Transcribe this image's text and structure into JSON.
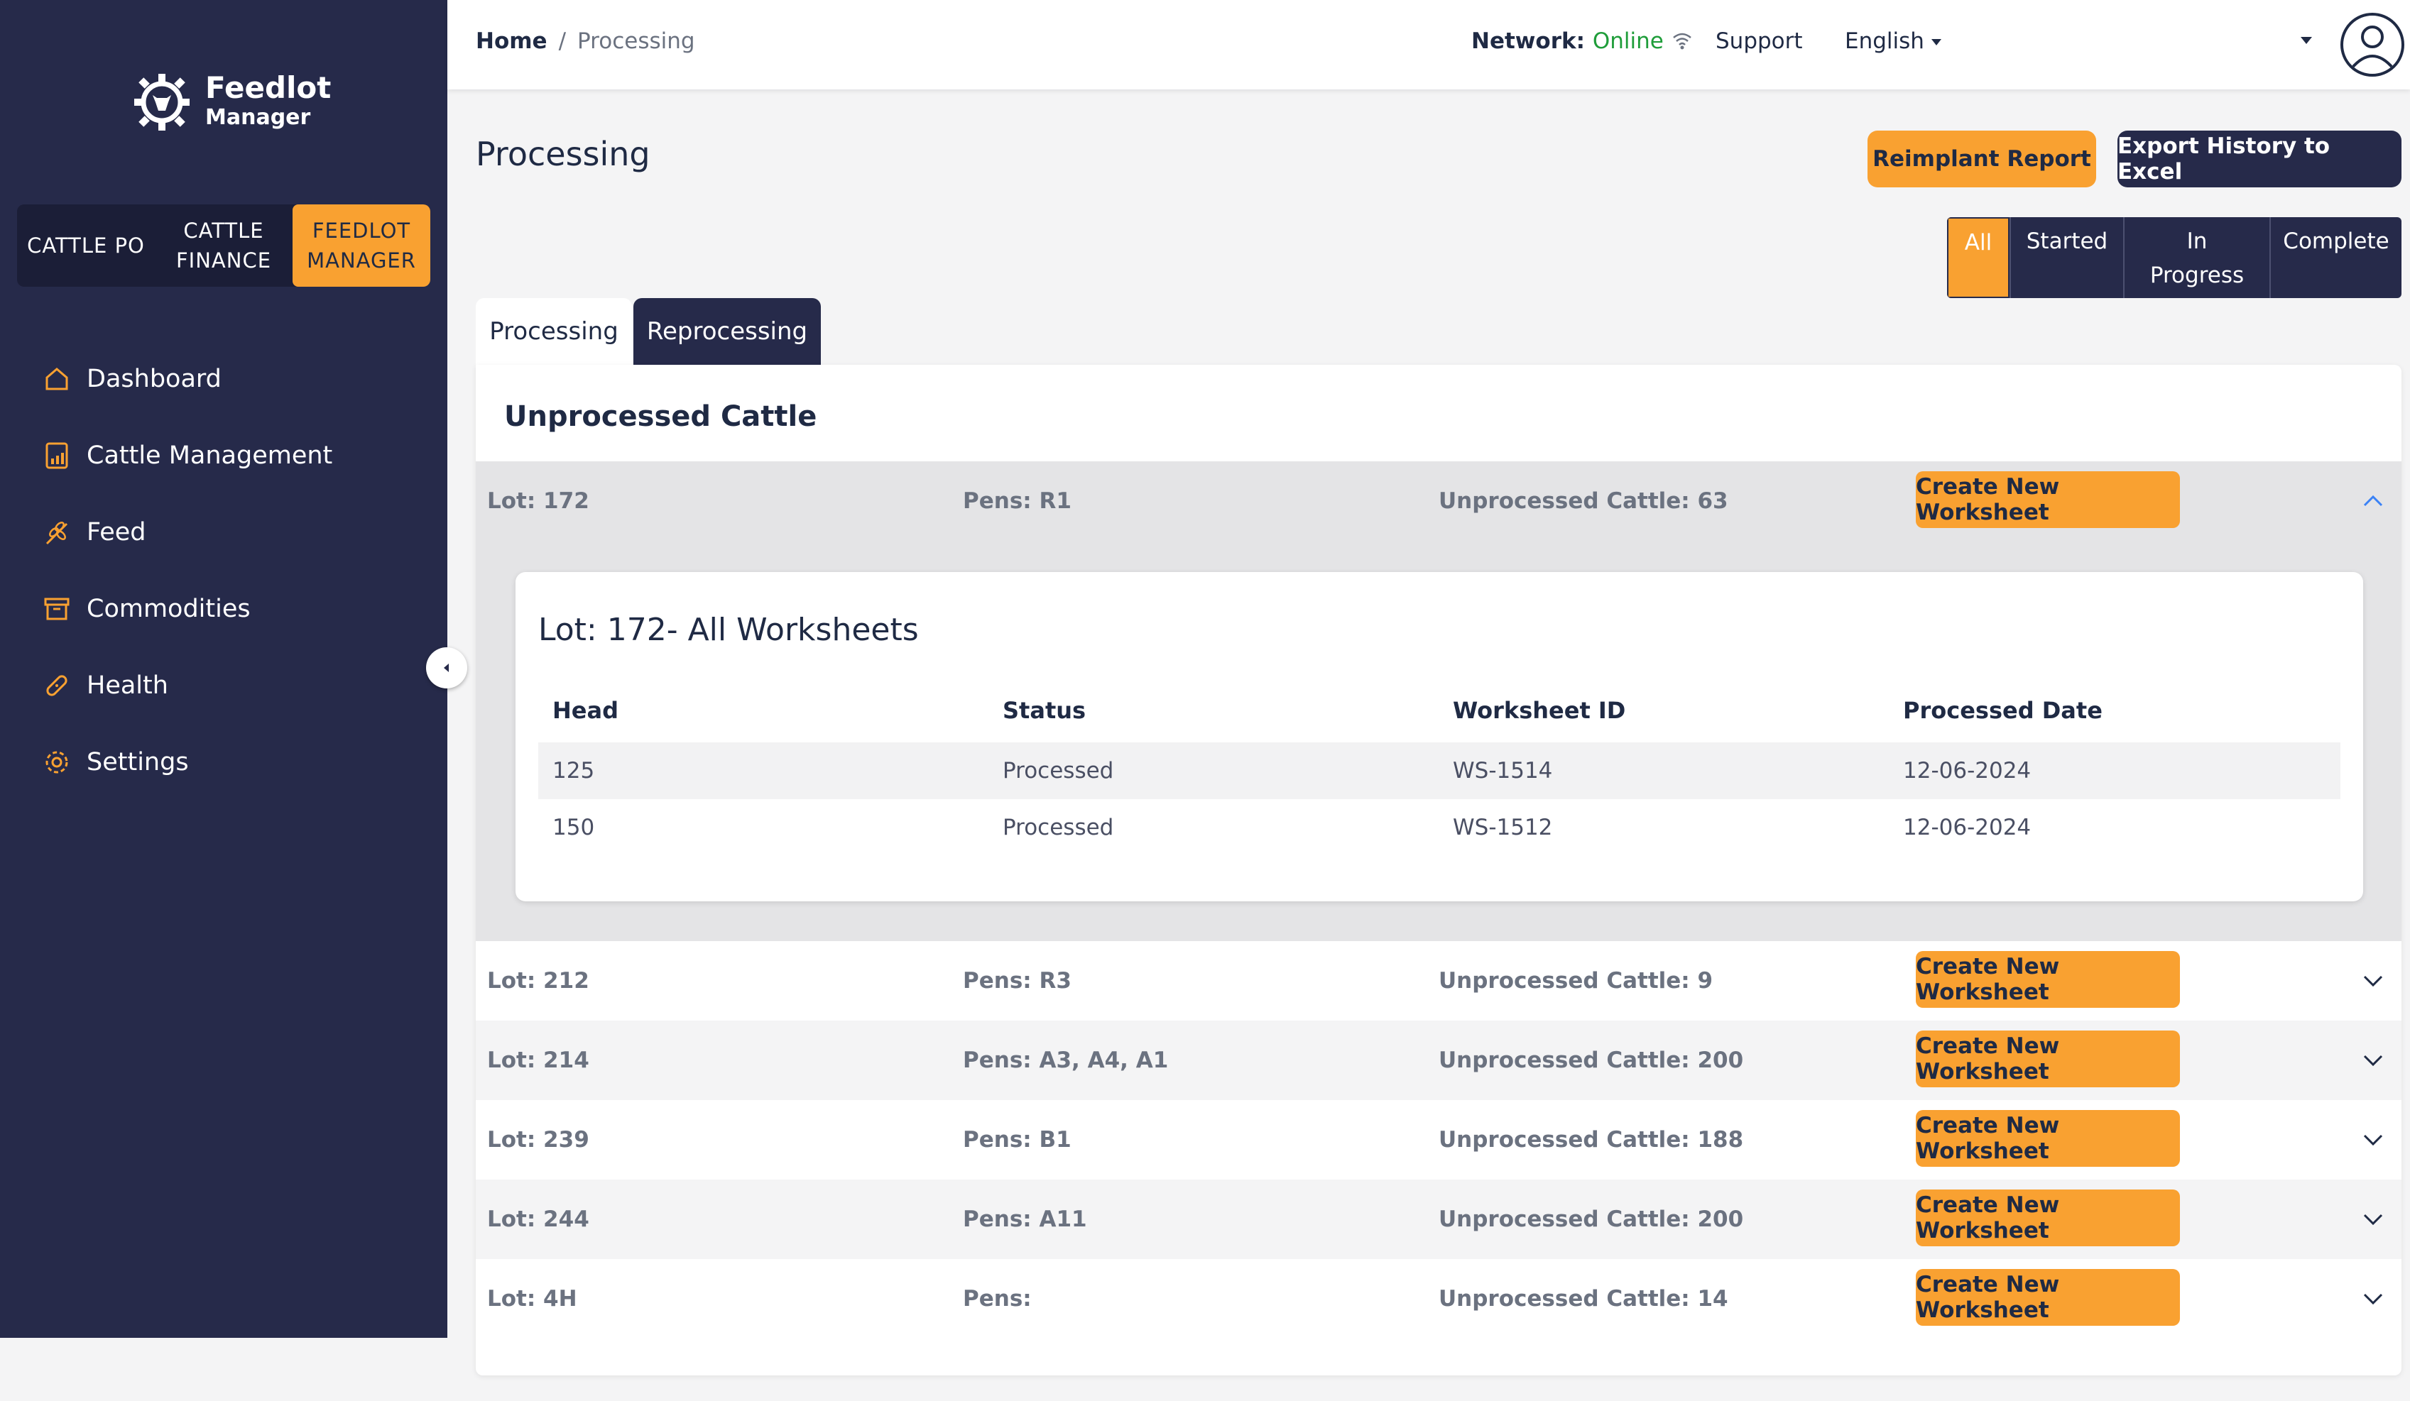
{
  "brand": {
    "title": "Feedlot",
    "subtitle": "Manager"
  },
  "switcher": [
    {
      "label": "CATTLE PO",
      "active": false
    },
    {
      "label": "CATTLE\nFINANCE",
      "active": false
    },
    {
      "label": "FEEDLOT\nMANAGER",
      "active": true
    }
  ],
  "nav": [
    {
      "label": "Dashboard",
      "icon": "home-icon"
    },
    {
      "label": "Cattle Management",
      "icon": "chart-tablet-icon"
    },
    {
      "label": "Feed",
      "icon": "wheat-icon"
    },
    {
      "label": "Commodities",
      "icon": "box-icon"
    },
    {
      "label": "Health",
      "icon": "bandage-icon"
    },
    {
      "label": "Settings",
      "icon": "gear-icon"
    }
  ],
  "header": {
    "breadcrumb": {
      "home": "Home",
      "separator": "/",
      "current": "Processing"
    },
    "network_label": "Network:",
    "network_status": "Online",
    "support": "Support",
    "language": "English"
  },
  "page": {
    "title": "Processing",
    "reimplant_label": "Reimplant Report",
    "export_label": "Export History to Excel",
    "filters": [
      {
        "label": "All",
        "active": true
      },
      {
        "label": "Started",
        "active": false
      },
      {
        "label": "In\nProgress",
        "active": false
      },
      {
        "label": "Complete",
        "active": false
      }
    ],
    "tabs": {
      "processing": "Processing",
      "reprocessing": "Reprocessing"
    },
    "section_title": "Unprocessed Cattle",
    "create_label": "Create New Worksheet"
  },
  "lots": [
    {
      "lot": "Lot: 172",
      "pens": "Pens: R1",
      "unprocessed": "Unprocessed Cattle: 63",
      "expanded": true
    },
    {
      "lot": "Lot: 212",
      "pens": "Pens: R3",
      "unprocessed": "Unprocessed Cattle: 9",
      "expanded": false
    },
    {
      "lot": "Lot: 214",
      "pens": "Pens: A3, A4, A1",
      "unprocessed": "Unprocessed Cattle: 200",
      "expanded": false
    },
    {
      "lot": "Lot: 239",
      "pens": "Pens: B1",
      "unprocessed": "Unprocessed Cattle: 188",
      "expanded": false
    },
    {
      "lot": "Lot: 244",
      "pens": "Pens: A11",
      "unprocessed": "Unprocessed Cattle: 200",
      "expanded": false
    },
    {
      "lot": "Lot: 4H",
      "pens": "Pens:",
      "unprocessed": "Unprocessed Cattle: 14",
      "expanded": false
    }
  ],
  "worksheets": {
    "title": "Lot: 172- All Worksheets",
    "columns": [
      "Head",
      "Status",
      "Worksheet ID",
      "Processed Date"
    ],
    "rows": [
      [
        "125",
        "Processed",
        "WS-1514",
        "12-06-2024"
      ],
      [
        "150",
        "Processed",
        "WS-1512",
        "12-06-2024"
      ]
    ]
  },
  "colors": {
    "sidebar": "#262a4a",
    "accent": "#f9a131",
    "online": "#1f9d3a"
  }
}
